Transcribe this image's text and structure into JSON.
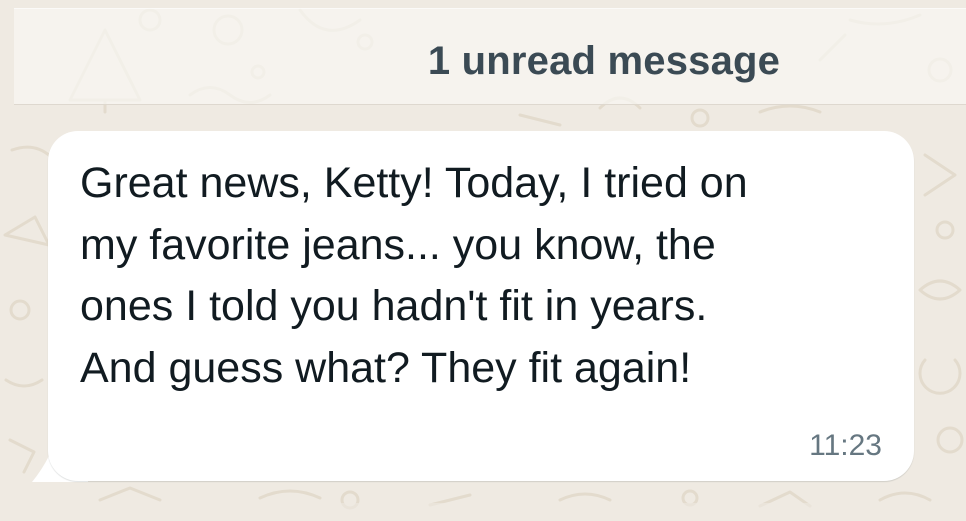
{
  "colors": {
    "wallpaper_bg": "#efeae2",
    "doodle": "#e3dbcd",
    "bubble_bg": "#ffffff",
    "message_text": "#111b21",
    "timestamp_text": "#667781",
    "unread_text": "#3b4a54"
  },
  "unread_divider": {
    "label": "1 unread message"
  },
  "message": {
    "direction": "incoming",
    "text": "Great news, Ketty! Today, I tried on\nmy favorite jeans... you know, the\nones I told you hadn't fit in years.\nAnd guess what? They fit again!",
    "time": "11:23"
  }
}
